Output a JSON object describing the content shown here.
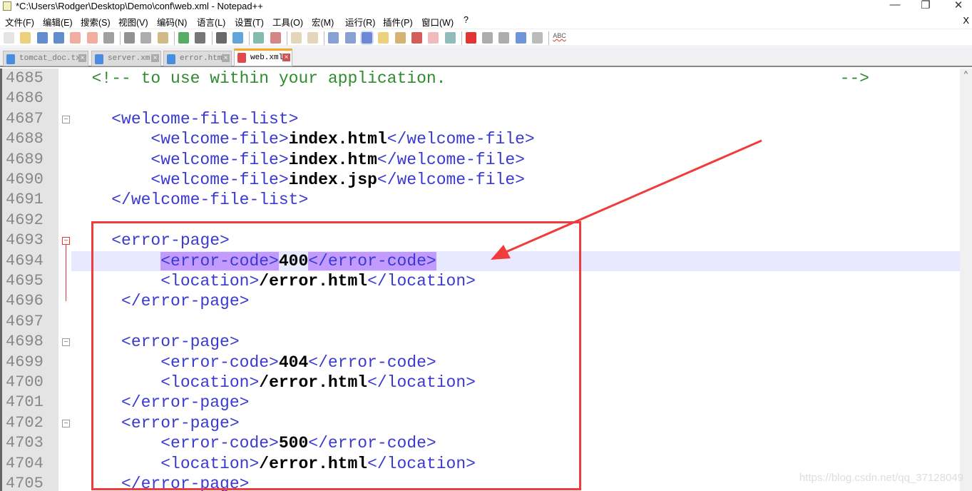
{
  "window": {
    "title": "*C:\\Users\\Rodger\\Desktop\\Demo\\conf\\web.xml - Notepad++",
    "minimize": "—",
    "restore": "❐",
    "close": "✕"
  },
  "menu": {
    "items": [
      "文件(F)",
      "编辑(E)",
      "搜索(S)",
      "视图(V)",
      "编码(N)",
      "语言(L)",
      "设置(T)",
      "工具(O)",
      "宏(M)",
      "运行(R)",
      "插件(P)",
      "窗口(W)",
      "?"
    ],
    "close": "X"
  },
  "toolbar": {
    "icons": [
      "new-file",
      "open-file",
      "save",
      "save-all",
      "close",
      "close-all",
      "print",
      "cut",
      "copy",
      "paste",
      "undo",
      "redo",
      "find",
      "replace",
      "zoom-in",
      "zoom-out",
      "sync-vertical",
      "sync-horizontal",
      "word-wrap",
      "show-all-chars",
      "indent-guide",
      "user-lang",
      "doc-map",
      "function-list",
      "folder-workspace",
      "monitoring",
      "record-macro",
      "stop-record",
      "play-macro",
      "run-macro-multiple",
      "save-macro",
      "spell-check"
    ],
    "spellcheck_label": "ABC"
  },
  "tabs": [
    {
      "label": "tomcat_doc.txt",
      "active": false
    },
    {
      "label": "server.xml",
      "active": false
    },
    {
      "label": "error.html",
      "active": false
    },
    {
      "label": "web.xml",
      "active": true
    }
  ],
  "editor": {
    "lines": [
      {
        "num": "4685",
        "tokens": [
          {
            "t": "  <!-- to use within your application.                                        -->",
            "c": "com"
          }
        ]
      },
      {
        "num": "4686",
        "tokens": []
      },
      {
        "num": "4687",
        "fold": "minus",
        "tokens": [
          {
            "t": "    ",
            "c": ""
          },
          {
            "t": "<welcome-file-list>",
            "c": "tag"
          }
        ]
      },
      {
        "num": "4688",
        "tokens": [
          {
            "t": "        ",
            "c": ""
          },
          {
            "t": "<welcome-file>",
            "c": "tag"
          },
          {
            "t": "index.html",
            "c": "txt"
          },
          {
            "t": "</welcome-file>",
            "c": "tag"
          }
        ]
      },
      {
        "num": "4689",
        "tokens": [
          {
            "t": "        ",
            "c": ""
          },
          {
            "t": "<welcome-file>",
            "c": "tag"
          },
          {
            "t": "index.htm",
            "c": "txt"
          },
          {
            "t": "</welcome-file>",
            "c": "tag"
          }
        ]
      },
      {
        "num": "4690",
        "tokens": [
          {
            "t": "        ",
            "c": ""
          },
          {
            "t": "<welcome-file>",
            "c": "tag"
          },
          {
            "t": "index.jsp",
            "c": "txt"
          },
          {
            "t": "</welcome-file>",
            "c": "tag"
          }
        ]
      },
      {
        "num": "4691",
        "tokens": [
          {
            "t": "    ",
            "c": ""
          },
          {
            "t": "</welcome-file-list>",
            "c": "tag"
          }
        ]
      },
      {
        "num": "4692",
        "tokens": []
      },
      {
        "num": "4693",
        "fold": "minus-red",
        "tokens": [
          {
            "t": "    ",
            "c": ""
          },
          {
            "t": "<error-page>",
            "c": "tag"
          }
        ]
      },
      {
        "num": "4694",
        "current": true,
        "tokens": [
          {
            "t": "         ",
            "c": ""
          },
          {
            "t": "<error-code>",
            "c": "tag hl"
          },
          {
            "t": "400",
            "c": "txt"
          },
          {
            "t": "</error-code>",
            "c": "tag hl"
          }
        ]
      },
      {
        "num": "4695",
        "tokens": [
          {
            "t": "         ",
            "c": ""
          },
          {
            "t": "<location>",
            "c": "tag"
          },
          {
            "t": "/error.html",
            "c": "txt"
          },
          {
            "t": "</location>",
            "c": "tag"
          }
        ]
      },
      {
        "num": "4696",
        "tokens": [
          {
            "t": "     ",
            "c": ""
          },
          {
            "t": "</error-page>",
            "c": "tag"
          }
        ]
      },
      {
        "num": "4697",
        "tokens": []
      },
      {
        "num": "4698",
        "fold": "minus",
        "tokens": [
          {
            "t": "     ",
            "c": ""
          },
          {
            "t": "<error-page>",
            "c": "tag"
          }
        ]
      },
      {
        "num": "4699",
        "tokens": [
          {
            "t": "         ",
            "c": ""
          },
          {
            "t": "<error-code>",
            "c": "tag"
          },
          {
            "t": "404",
            "c": "txt"
          },
          {
            "t": "</error-code>",
            "c": "tag"
          }
        ]
      },
      {
        "num": "4700",
        "tokens": [
          {
            "t": "         ",
            "c": ""
          },
          {
            "t": "<location>",
            "c": "tag"
          },
          {
            "t": "/error.html",
            "c": "txt"
          },
          {
            "t": "</location>",
            "c": "tag"
          }
        ]
      },
      {
        "num": "4701",
        "tokens": [
          {
            "t": "     ",
            "c": ""
          },
          {
            "t": "</error-page>",
            "c": "tag"
          }
        ]
      },
      {
        "num": "4702",
        "fold": "minus",
        "tokens": [
          {
            "t": "     ",
            "c": ""
          },
          {
            "t": "<error-page>",
            "c": "tag"
          }
        ]
      },
      {
        "num": "4703",
        "tokens": [
          {
            "t": "         ",
            "c": ""
          },
          {
            "t": "<error-code>",
            "c": "tag"
          },
          {
            "t": "500",
            "c": "txt"
          },
          {
            "t": "</error-code>",
            "c": "tag"
          }
        ]
      },
      {
        "num": "4704",
        "tokens": [
          {
            "t": "         ",
            "c": ""
          },
          {
            "t": "<location>",
            "c": "tag"
          },
          {
            "t": "/error.html",
            "c": "txt"
          },
          {
            "t": "</location>",
            "c": "tag"
          }
        ]
      },
      {
        "num": "4705",
        "tokens": [
          {
            "t": "     ",
            "c": ""
          },
          {
            "t": "</error-page>",
            "c": "tag"
          }
        ]
      }
    ]
  },
  "annotation_color": "#f03c3c",
  "watermark": "https://blog.csdn.net/qq_37128049"
}
